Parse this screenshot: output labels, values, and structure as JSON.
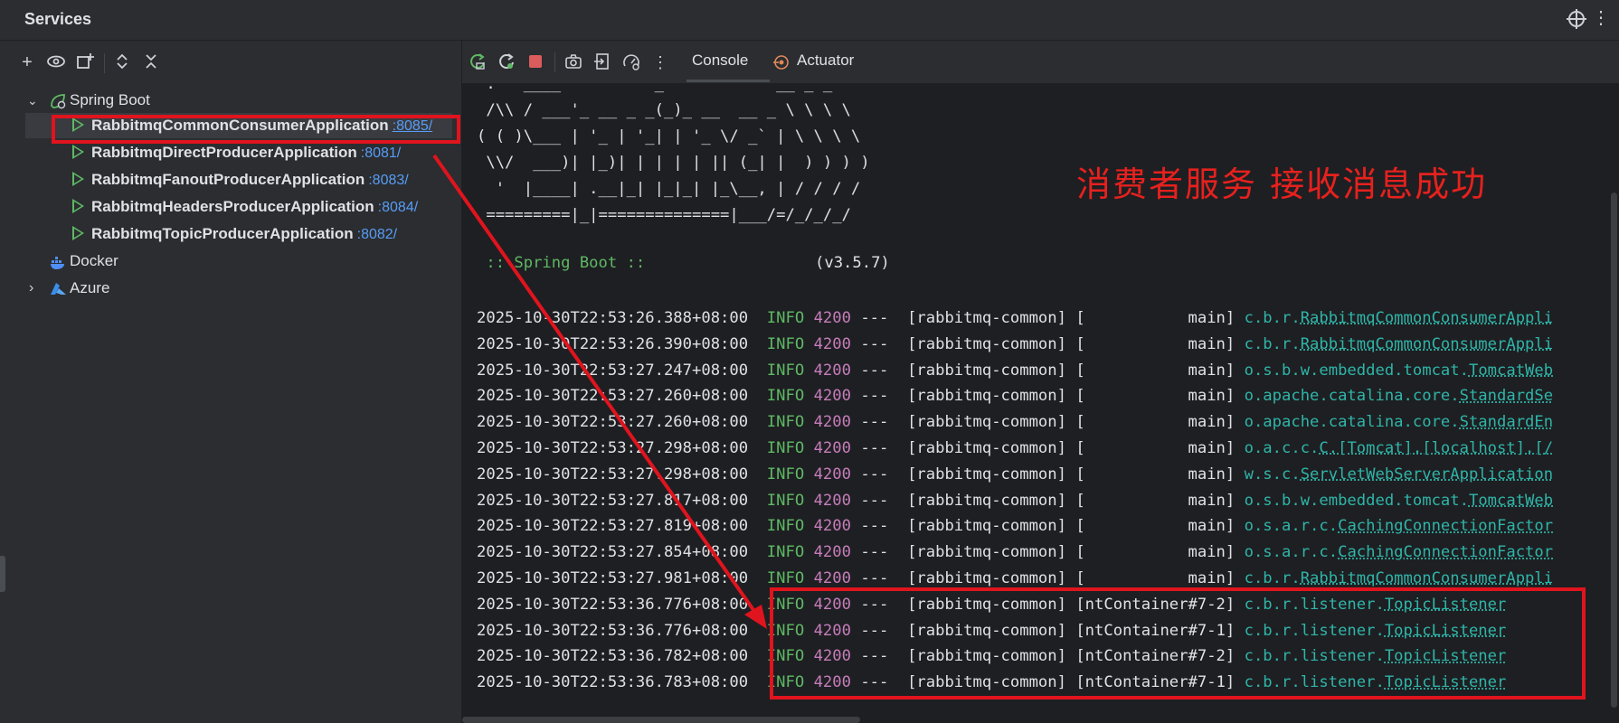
{
  "window": {
    "title": "Services"
  },
  "services_toolbar": {
    "add_icon": "plus-icon",
    "view_icon": "eye-icon",
    "new_group_icon": "add-group-icon",
    "expand_icon": "expand-all-icon",
    "collapse_icon": "collapse-all-icon"
  },
  "tree": {
    "spring_boot": {
      "label": "Spring Boot"
    },
    "apps": [
      {
        "name": "RabbitmqCommonConsumerApplication",
        "port": ":8085/"
      },
      {
        "name": "RabbitmqDirectProducerApplication",
        "port": ":8081/"
      },
      {
        "name": "RabbitmqFanoutProducerApplication",
        "port": ":8083/"
      },
      {
        "name": "RabbitmqHeadersProducerApplication",
        "port": ":8084/"
      },
      {
        "name": "RabbitmqTopicProducerApplication",
        "port": ":8082/"
      }
    ],
    "docker": {
      "label": "Docker"
    },
    "azure": {
      "label": "Azure"
    }
  },
  "console_toolbar": {
    "tabs": [
      {
        "label": "Console"
      },
      {
        "label": "Actuator"
      }
    ]
  },
  "console": {
    "banner": [
      " .   ____          _            __ _ _",
      " /\\\\ / ___'_ __ _ _(_)_ __  __ _ \\ \\ \\ \\",
      "( ( )\\___ | '_ | '_| | '_ \\/ _` | \\ \\ \\ \\",
      " \\\\/  ___)| |_)| | | | | || (_| |  ) ) ) )",
      "  '  |____| .__|_| |_|_| |_\\__, | / / / /",
      " =========|_|==============|___/=/_/_/_/"
    ],
    "boot_label": " :: Spring Boot ::",
    "boot_version": "(v3.5.7)",
    "logs": [
      {
        "ts": "2025-10-30T22:53:26.388+08:00",
        "level": "INFO",
        "pid": "4200",
        "thread": "---  [rabbitmq-common] [           main]",
        "pkg": "c.b.r.",
        "cls": "RabbitmqCommonConsumerAppli"
      },
      {
        "ts": "2025-10-30T22:53:26.390+08:00",
        "level": "INFO",
        "pid": "4200",
        "thread": "---  [rabbitmq-common] [           main]",
        "pkg": "c.b.r.",
        "cls": "RabbitmqCommonConsumerAppli"
      },
      {
        "ts": "2025-10-30T22:53:27.247+08:00",
        "level": "INFO",
        "pid": "4200",
        "thread": "---  [rabbitmq-common] [           main]",
        "pkg": "o.s.b.w.embedded.tomcat.",
        "cls": "TomcatWeb"
      },
      {
        "ts": "2025-10-30T22:53:27.260+08:00",
        "level": "INFO",
        "pid": "4200",
        "thread": "---  [rabbitmq-common] [           main]",
        "pkg": "o.apache.catalina.core.",
        "cls": "StandardSe"
      },
      {
        "ts": "2025-10-30T22:53:27.260+08:00",
        "level": "INFO",
        "pid": "4200",
        "thread": "---  [rabbitmq-common] [           main]",
        "pkg": "o.apache.catalina.core.",
        "cls": "StandardEn"
      },
      {
        "ts": "2025-10-30T22:53:27.298+08:00",
        "level": "INFO",
        "pid": "4200",
        "thread": "---  [rabbitmq-common] [           main]",
        "pkg": "o.a.c.c.",
        "cls": "C.[Tomcat].[localhost].[/"
      },
      {
        "ts": "2025-10-30T22:53:27.298+08:00",
        "level": "INFO",
        "pid": "4200",
        "thread": "---  [rabbitmq-common] [           main]",
        "pkg": "w.s.c.",
        "cls": "ServletWebServerApplication"
      },
      {
        "ts": "2025-10-30T22:53:27.817+08:00",
        "level": "INFO",
        "pid": "4200",
        "thread": "---  [rabbitmq-common] [           main]",
        "pkg": "o.s.b.w.embedded.tomcat.",
        "cls": "TomcatWeb"
      },
      {
        "ts": "2025-10-30T22:53:27.819+08:00",
        "level": "INFO",
        "pid": "4200",
        "thread": "---  [rabbitmq-common] [           main]",
        "pkg": "o.s.a.r.c.",
        "cls": "CachingConnectionFactor"
      },
      {
        "ts": "2025-10-30T22:53:27.854+08:00",
        "level": "INFO",
        "pid": "4200",
        "thread": "---  [rabbitmq-common] [           main]",
        "pkg": "o.s.a.r.c.",
        "cls": "CachingConnectionFactor"
      },
      {
        "ts": "2025-10-30T22:53:27.981+08:00",
        "level": "INFO",
        "pid": "4200",
        "thread": "---  [rabbitmq-common] [           main]",
        "pkg": "c.b.r.",
        "cls": "RabbitmqCommonConsumerAppli"
      },
      {
        "ts": "2025-10-30T22:53:36.776+08:00",
        "level": "INFO",
        "pid": "4200",
        "thread": "---  [rabbitmq-common] [ntContainer#7-2]",
        "pkg": "c.b.r.listener.",
        "cls": "TopicListener"
      },
      {
        "ts": "2025-10-30T22:53:36.776+08:00",
        "level": "INFO",
        "pid": "4200",
        "thread": "---  [rabbitmq-common] [ntContainer#7-1]",
        "pkg": "c.b.r.listener.",
        "cls": "TopicListener"
      },
      {
        "ts": "2025-10-30T22:53:36.782+08:00",
        "level": "INFO",
        "pid": "4200",
        "thread": "---  [rabbitmq-common] [ntContainer#7-2]",
        "pkg": "c.b.r.listener.",
        "cls": "TopicListener"
      },
      {
        "ts": "2025-10-30T22:53:36.783+08:00",
        "level": "INFO",
        "pid": "4200",
        "thread": "---  [rabbitmq-common] [ntContainer#7-1]",
        "pkg": "c.b.r.listener.",
        "cls": "TopicListener"
      }
    ]
  },
  "annotation": {
    "text": "消费者服务 接收消息成功",
    "color": "#e6211e"
  },
  "colors": {
    "accent_green": "#5fb865",
    "link_blue": "#589df6",
    "pid_purple": "#c77dbb",
    "logger_teal": "#2fb5a9",
    "highlight_red": "#e0141e"
  }
}
